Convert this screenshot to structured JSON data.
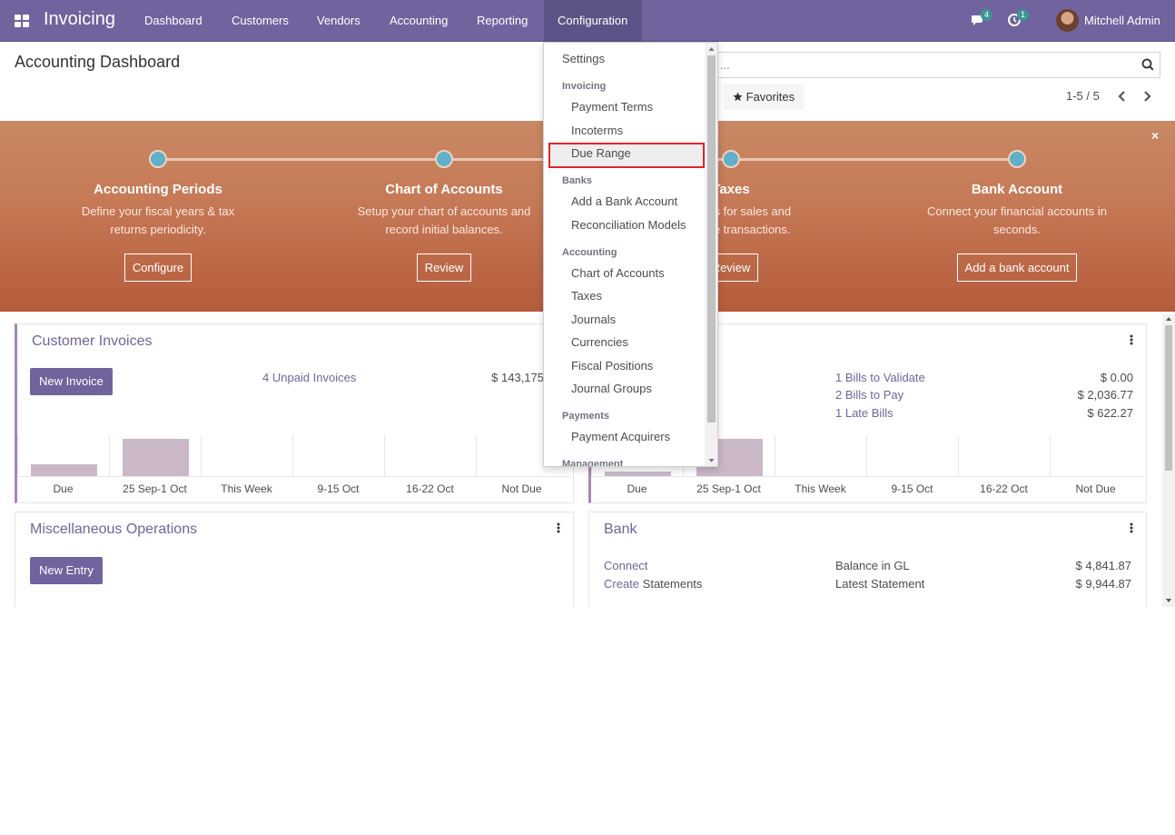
{
  "navbar": {
    "app_name": "Invoicing",
    "menu": [
      "Dashboard",
      "Customers",
      "Vendors",
      "Accounting",
      "Reporting",
      "Configuration"
    ],
    "active_menu": "Configuration",
    "messages_count": "4",
    "activities_count": "1",
    "user_name": "Mitchell Admin"
  },
  "control_panel": {
    "title": "Accounting Dashboard",
    "search_placeholder": "...",
    "favorites_label": "Favorites",
    "pager_value": "1-5 / 5"
  },
  "onboarding": {
    "steps": [
      {
        "title": "Accounting Periods",
        "desc1": "Define your fiscal years & tax",
        "desc2": "returns periodicity.",
        "button": "Configure"
      },
      {
        "title": "Chart of Accounts",
        "desc1": "Setup your chart of accounts and",
        "desc2": "record initial balances.",
        "button": "Review"
      },
      {
        "title": "Taxes",
        "desc1": "Set taxes for sales and",
        "desc2": "purchase transactions.",
        "button": "Review"
      },
      {
        "title": "Bank Account",
        "desc1": "Connect your financial accounts in",
        "desc2": "seconds.",
        "button": "Add a bank account"
      }
    ],
    "close_glyph": "×"
  },
  "customer_invoices": {
    "title": "Customer Invoices",
    "new_button": "New Invoice",
    "unpaid_link": "4 Unpaid Invoices",
    "unpaid_amount": "$ 143,175",
    "graph_labels": [
      "Due",
      "25 Sep-1 Oct",
      "This Week",
      "9-15 Oct",
      "16-22 Oct",
      "Not Due"
    ],
    "graph_values": [
      10,
      31,
      0,
      0,
      0,
      0
    ]
  },
  "vendor_bills": {
    "lines": [
      {
        "label": "1 Bills to Validate",
        "amount": "$ 0.00"
      },
      {
        "label": "2 Bills to Pay",
        "amount": "$ 2,036.77"
      },
      {
        "label": "1 Late Bills",
        "amount": "$ 622.27"
      }
    ],
    "graph_labels": [
      "Due",
      "25 Sep-1 Oct",
      "This Week",
      "9-15 Oct",
      "16-22 Oct",
      "Not Due"
    ],
    "graph_values": [
      6,
      42,
      0,
      0,
      0,
      0
    ]
  },
  "misc_operations": {
    "title": "Miscellaneous Operations",
    "new_button": "New Entry"
  },
  "bank": {
    "title": "Bank",
    "connect_link": "Connect",
    "create_link": "Create",
    "statements_text": "Statements",
    "balance_label": "Balance in GL",
    "balance_amount": "$ 4,841.87",
    "latest_label": "Latest Statement",
    "latest_amount": "$ 9,944.87"
  },
  "config_menu": {
    "settings": "Settings",
    "invoicing_header": "Invoicing",
    "payment_terms": "Payment Terms",
    "incoterms": "Incoterms",
    "due_range": "Due Range",
    "banks_header": "Banks",
    "add_bank_account": "Add a Bank Account",
    "reconciliation_models": "Reconciliation Models",
    "accounting_header": "Accounting",
    "chart_of_accounts": "Chart of Accounts",
    "taxes": "Taxes",
    "journals": "Journals",
    "currencies": "Currencies",
    "fiscal_positions": "Fiscal Positions",
    "journal_groups": "Journal Groups",
    "payments_header": "Payments",
    "payment_acquirers": "Payment Acquirers",
    "management_header": "Management"
  },
  "colors": {
    "navbar": "#71639e",
    "banner": "#c67a57",
    "accent": "#a887b8",
    "highlight_border": "#e0242e"
  }
}
